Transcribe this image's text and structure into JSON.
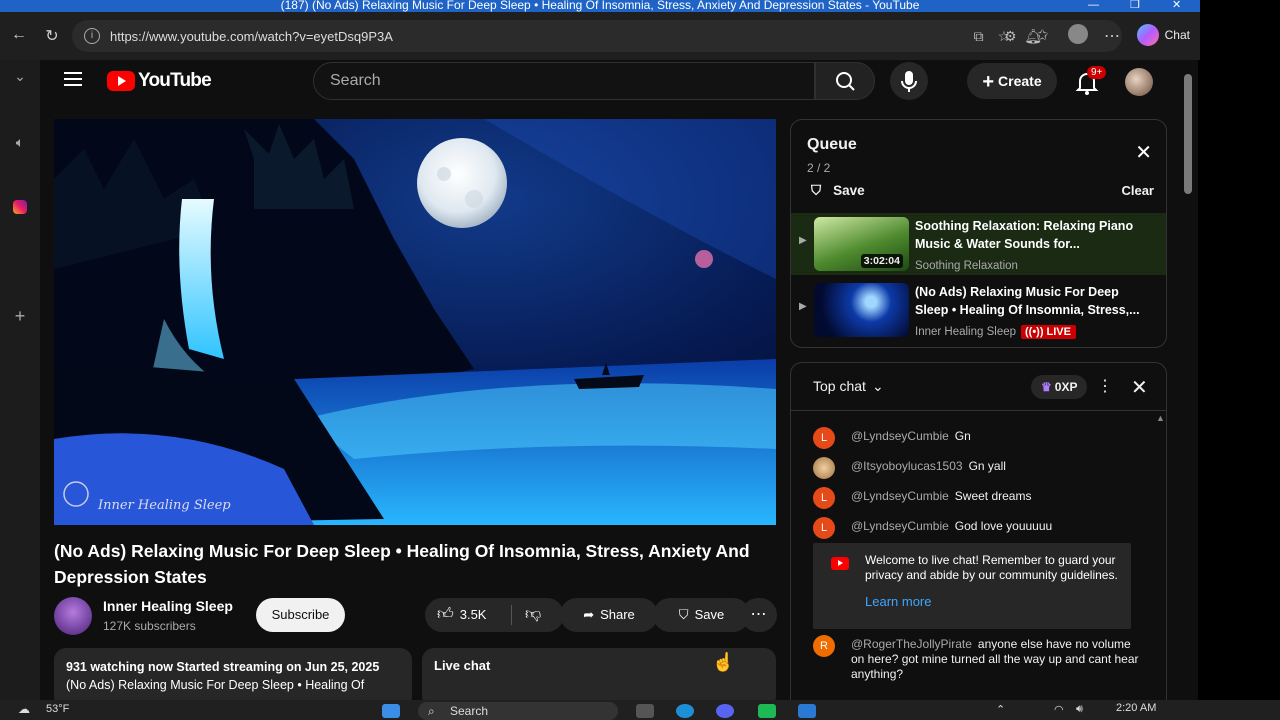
{
  "browser": {
    "window_title": "(187) (No Ads) Relaxing Music For Deep Sleep • Healing Of Insomnia, Stress, Anxiety And Depression States - YouTube",
    "url": "https://www.youtube.com/watch?v=eyetDsq9P3A",
    "copilot_label": "Chat"
  },
  "header": {
    "logo_text": "YouTube",
    "search_placeholder": "Search",
    "create_label": "Create",
    "notification_count": "9+"
  },
  "video": {
    "title": "(No Ads) Relaxing Music For Deep Sleep • Healing Of Insomnia, Stress, Anxiety And Depression States",
    "watermark": "Inner Healing Sleep",
    "channel_name": "Inner Healing Sleep",
    "subscribers": "127K subscribers",
    "subscribe_label": "Subscribe",
    "likes": "3.5K",
    "share_label": "Share",
    "save_label": "Save",
    "description_line1": "931 watching now  Started streaming on Jun 25, 2025",
    "description_line2": "(No Ads) Relaxing Music For Deep Sleep • Healing Of",
    "live_chat_label": "Live chat"
  },
  "queue": {
    "title": "Queue",
    "count": "2 / 2",
    "save_label": "Save",
    "clear_label": "Clear",
    "items": [
      {
        "title": "Soothing Relaxation: Relaxing Piano Music & Water Sounds for...",
        "channel": "Soothing Relaxation",
        "duration": "3:02:04"
      },
      {
        "title": "(No Ads) Relaxing Music For Deep Sleep • Healing Of Insomnia, Stress,...",
        "channel": "Inner Healing Sleep",
        "badge": "LIVE"
      }
    ]
  },
  "chat": {
    "mode": "Top chat",
    "xp": "0XP",
    "messages": [
      {
        "initial": "L",
        "author": "@LyndseyCumbie",
        "text": "Gn"
      },
      {
        "initial": "",
        "author": "@Itsyoboylucas1503",
        "text": "Gn yall"
      },
      {
        "initial": "L",
        "author": "@LyndseyCumbie",
        "text": "Sweet dreams"
      },
      {
        "initial": "L",
        "author": "@LyndseyCumbie",
        "text": "God love youuuuu"
      },
      {
        "initial": "R",
        "author": "@RogerTheJollyPirate",
        "text": "anyone else have no volume on here? got mine turned all the way up and cant hear anything?"
      }
    ],
    "welcome_text": "Welcome to live chat! Remember to guard your privacy and abide by our community guidelines.",
    "learn_more": "Learn more"
  },
  "taskbar": {
    "weather_temp": "53°F",
    "search_label": "Search",
    "time": "2:20 AM"
  },
  "colors": {
    "brand_red": "#ff0000",
    "link_blue": "#3ea6ff",
    "live_red": "#cc0000"
  }
}
